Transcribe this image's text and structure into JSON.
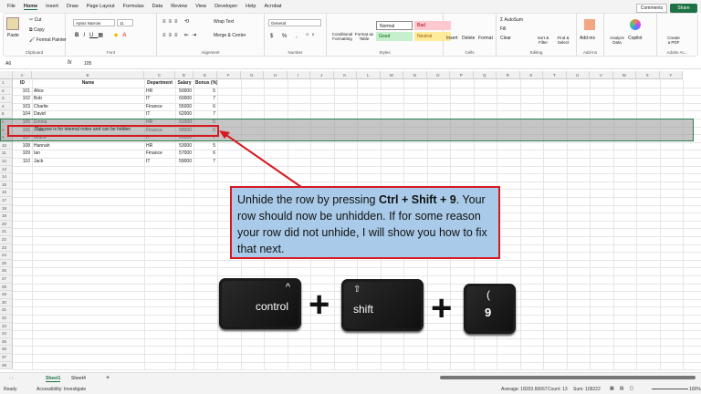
{
  "menu": [
    "File",
    "Home",
    "Insert",
    "Draw",
    "Page Layout",
    "Formulas",
    "Data",
    "Review",
    "View",
    "Developer",
    "Help",
    "Acrobat"
  ],
  "top_buttons": {
    "comments": "Comments",
    "share": "Share"
  },
  "ribbon": {
    "clipboard": {
      "paste": "Paste",
      "cut": "Cut",
      "copy": "Copy",
      "format_painter": "Format Painter",
      "label": "Clipboard"
    },
    "font": {
      "name": "Aptos Narrow",
      "size": "11",
      "label": "Font"
    },
    "alignment": {
      "wrap": "Wrap Text",
      "merge": "Merge & Center",
      "label": "Alignment"
    },
    "number": {
      "format": "General",
      "label": "Number"
    },
    "styles": {
      "conditional": "Conditional Formatting",
      "format_table": "Format as Table",
      "normal": "Normal",
      "bad": "Bad",
      "good": "Good",
      "neutral": "Neutral",
      "label": "Styles"
    },
    "cells": {
      "insert": "Insert",
      "delete": "Delete",
      "format": "Format",
      "label": "Cells"
    },
    "editing": {
      "autosum": "AutoSum",
      "fill": "Fill",
      "clear": "Clear",
      "sort": "Sort & Filter",
      "find": "Find & Select",
      "label": "Editing"
    },
    "addins": {
      "addins": "Add-ins",
      "label": "Add-ins"
    },
    "analyze": "Analyze Data",
    "copilot": "Copilot",
    "adobe": {
      "create": "Create a PDF",
      "label": "Adobe Ac..."
    }
  },
  "formula_bar": {
    "name_box": "A6",
    "fx": "fx",
    "value": "105"
  },
  "columns": [
    "A",
    "B",
    "C",
    "D",
    "E",
    "F",
    "G",
    "H",
    "I",
    "J",
    "K",
    "L",
    "M",
    "N",
    "O",
    "P",
    "Q",
    "R",
    "S",
    "T",
    "U",
    "V",
    "W",
    "X",
    "Y"
  ],
  "headers": [
    "ID",
    "Name",
    "Department",
    "Salary",
    "Bonus (%)"
  ],
  "rows": [
    {
      "num": "2",
      "cells": [
        "101",
        "Alice",
        "HR",
        "50000",
        "5"
      ]
    },
    {
      "num": "3",
      "cells": [
        "102",
        "Bob",
        "IT",
        "60000",
        "7"
      ]
    },
    {
      "num": "4",
      "cells": [
        "103",
        "Charlie",
        "Finance",
        "55000",
        "6"
      ]
    },
    {
      "num": "5",
      "cells": [
        "104",
        "David",
        "IT",
        "62000",
        "7"
      ]
    },
    {
      "num": "6",
      "cells": [
        "105",
        "Emma",
        "HR",
        "51000",
        "5"
      ]
    },
    {
      "num": "8",
      "cells": [
        "106",
        "Frank",
        "Finance",
        "58000",
        "6"
      ]
    },
    {
      "num": "9",
      "cells": [
        "107",
        "Grace",
        "IT",
        "61000",
        "7"
      ]
    },
    {
      "num": "10",
      "cells": [
        "108",
        "Hannah",
        "HR",
        "53000",
        "5"
      ]
    },
    {
      "num": "11",
      "cells": [
        "109",
        "Ian",
        "Finance",
        "57000",
        "6"
      ]
    },
    {
      "num": "12",
      "cells": [
        "110",
        "Jack",
        "IT",
        "59000",
        "7"
      ]
    }
  ],
  "hidden_row_note": "This row is for internal notes and can be hidden",
  "callout": {
    "pre": "Unhide the row by pressing ",
    "shortcut": "Ctrl + Shift + 9",
    "post": ". Your row should now be unhidden. If for some reason your row did not unhide, I will show you how to fix that next."
  },
  "keys": {
    "control": "control",
    "control_sym": "^",
    "shift": "shift",
    "shift_sym": "⇧",
    "nine": "9",
    "nine_sym": "(",
    "plus": "+"
  },
  "sheets": [
    "Sheet1",
    "Sheet4"
  ],
  "status": {
    "ready": "Ready",
    "accessibility": "Accessibility: Investigate",
    "average": "Average: 18203.66667",
    "count": "Count: 13",
    "sum": "Sum: 109222",
    "zoom": "100%"
  },
  "colors": {
    "excel_green": "#1e7145",
    "callout_bg": "#a9cbe9",
    "highlight_red": "#d71920"
  }
}
